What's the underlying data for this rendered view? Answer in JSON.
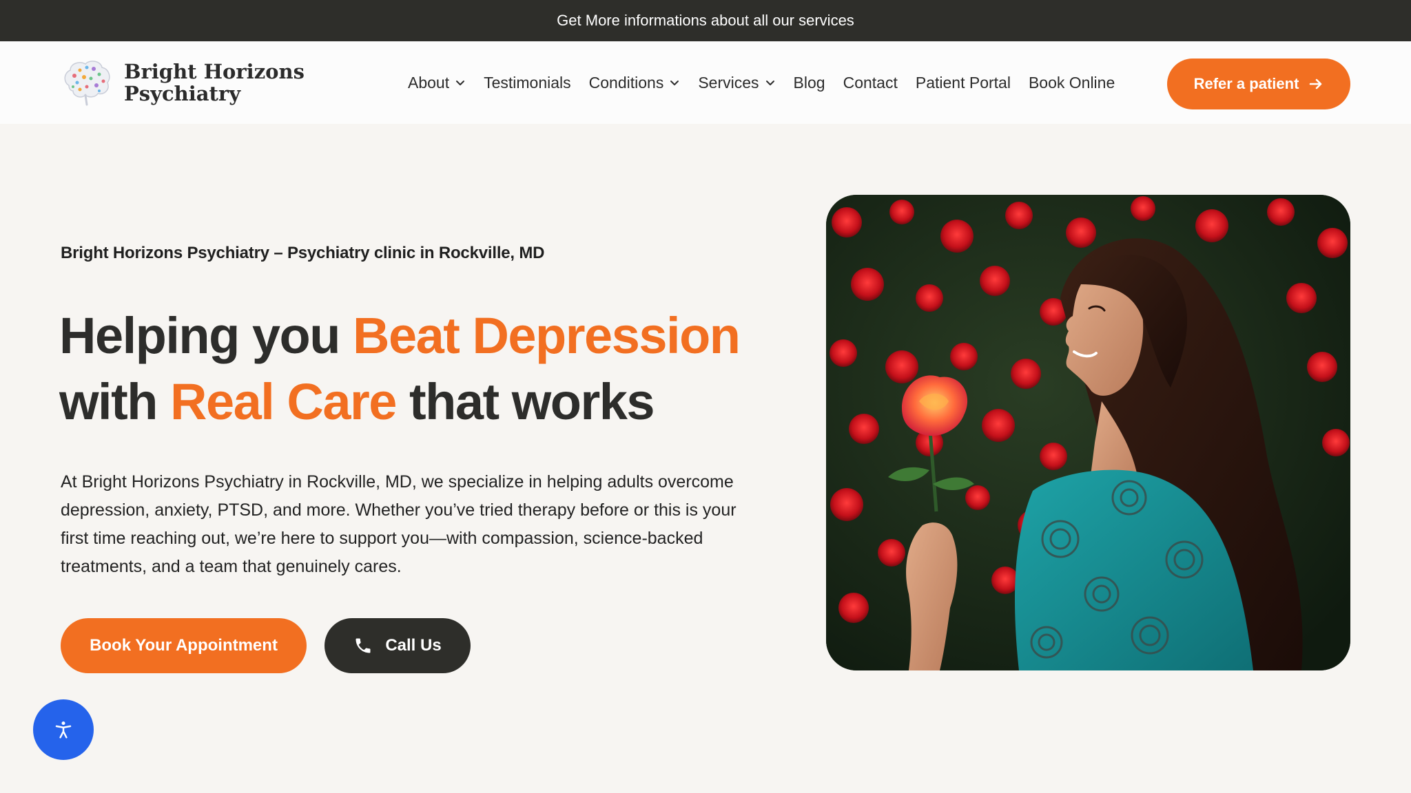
{
  "topbar": {
    "text": "Get More informations about all our services"
  },
  "header": {
    "logo": {
      "line1": "Bright Horizons",
      "line2": "Psychiatry",
      "icon": "brain-icon"
    },
    "nav": [
      {
        "label": "About",
        "dropdown": true
      },
      {
        "label": "Testimonials",
        "dropdown": false
      },
      {
        "label": "Conditions",
        "dropdown": true
      },
      {
        "label": "Services",
        "dropdown": true
      },
      {
        "label": "Blog",
        "dropdown": false
      },
      {
        "label": "Contact",
        "dropdown": false
      },
      {
        "label": "Patient Portal",
        "dropdown": false
      },
      {
        "label": "Book Online",
        "dropdown": false
      }
    ],
    "cta": {
      "label": "Refer a patient",
      "icon": "arrow-right-icon"
    }
  },
  "hero": {
    "kicker": "Bright Horizons Psychiatry – Psychiatry clinic in Rockville, MD",
    "headline": {
      "part1": "Helping you ",
      "highlight1": "Beat Depression",
      "part2": "with ",
      "highlight2": "Real Care",
      "part3": " that works"
    },
    "body": "At Bright Horizons Psychiatry in Rockville, MD, we specialize in helping adults overcome depression, anxiety, PTSD, and more. Whether you’ve tried therapy before or this is your first time reaching out, we’re here to support you—with compassion, science-backed treatments, and a team that genuinely cares.",
    "primary_button": "Book Your Appointment",
    "secondary_button": {
      "label": "Call Us",
      "icon": "phone-icon"
    }
  },
  "accessibility": {
    "icon": "accessibility-icon"
  },
  "colors": {
    "accent": "#f26f21",
    "dark": "#2e2e2a",
    "background": "#f7f5f2",
    "accessibility": "#2563eb"
  }
}
